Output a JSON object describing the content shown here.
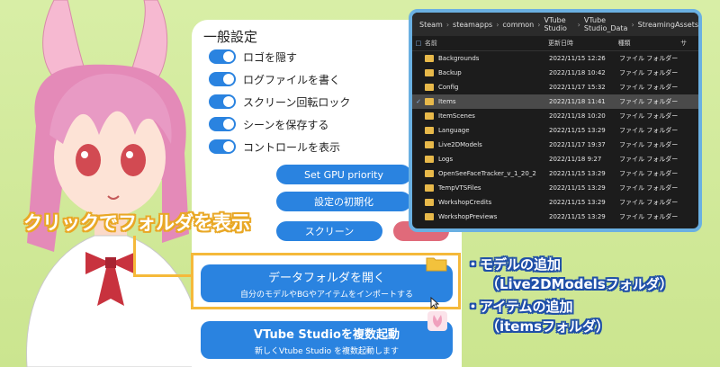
{
  "settings": {
    "title": "一般設定",
    "toggles": [
      "ロゴを隠す",
      "ログファイルを書く",
      "スクリーン回転ロック",
      "シーンを保存する",
      "コントロールを表示"
    ],
    "gpu_button": "Set GPU priority",
    "reset_button": "設定の初期化",
    "fullscreen_button": "スクリーン",
    "data_folder": {
      "title": "データフォルダを開く",
      "subtitle": "自分のモデルやBGやアイテムをインポートする"
    },
    "multi_launch": {
      "title": "VTube Studioを複数起動",
      "subtitle": "新しくVtube Studio を複数起動します"
    }
  },
  "callout": "クリックでフォルダを表示",
  "explorer": {
    "path": [
      "Steam",
      "steamapps",
      "common",
      "VTube Studio",
      "VTube Studio_Data",
      "StreamingAssets"
    ],
    "columns": {
      "name": "名前",
      "date": "更新日時",
      "type": "種類",
      "size": "サ"
    },
    "rows": [
      {
        "name": "Backgrounds",
        "date": "2022/11/15 12:26",
        "type": "ファイル フォルダー"
      },
      {
        "name": "Backup",
        "date": "2022/11/18 10:42",
        "type": "ファイル フォルダー"
      },
      {
        "name": "Config",
        "date": "2022/11/17 15:32",
        "type": "ファイル フォルダー"
      },
      {
        "name": "Items",
        "date": "2022/11/18 11:41",
        "type": "ファイル フォルダー",
        "selected": true
      },
      {
        "name": "ItemScenes",
        "date": "2022/11/18 10:20",
        "type": "ファイル フォルダー"
      },
      {
        "name": "Language",
        "date": "2022/11/15 13:29",
        "type": "ファイル フォルダー"
      },
      {
        "name": "Live2DModels",
        "date": "2022/11/17 19:37",
        "type": "ファイル フォルダー"
      },
      {
        "name": "Logs",
        "date": "2022/11/18 9:27",
        "type": "ファイル フォルダー"
      },
      {
        "name": "OpenSeeFaceTracker_v_1_20_2",
        "date": "2022/11/15 13:29",
        "type": "ファイル フォルダー"
      },
      {
        "name": "TempVTSFiles",
        "date": "2022/11/15 13:29",
        "type": "ファイル フォルダー"
      },
      {
        "name": "WorkshopCredits",
        "date": "2022/11/15 13:29",
        "type": "ファイル フォルダー"
      },
      {
        "name": "WorkshopPreviews",
        "date": "2022/11/15 13:29",
        "type": "ファイル フォルダー"
      }
    ]
  },
  "notes": [
    "・モデルの追加",
    "（Live2DModelsフォルダ）",
    "・アイテムの追加",
    "（itemsフォルダ）"
  ],
  "colors": {
    "accent": "#2a83e0",
    "callout": "#f5b93a",
    "note_outline": "#1f4fa8"
  }
}
